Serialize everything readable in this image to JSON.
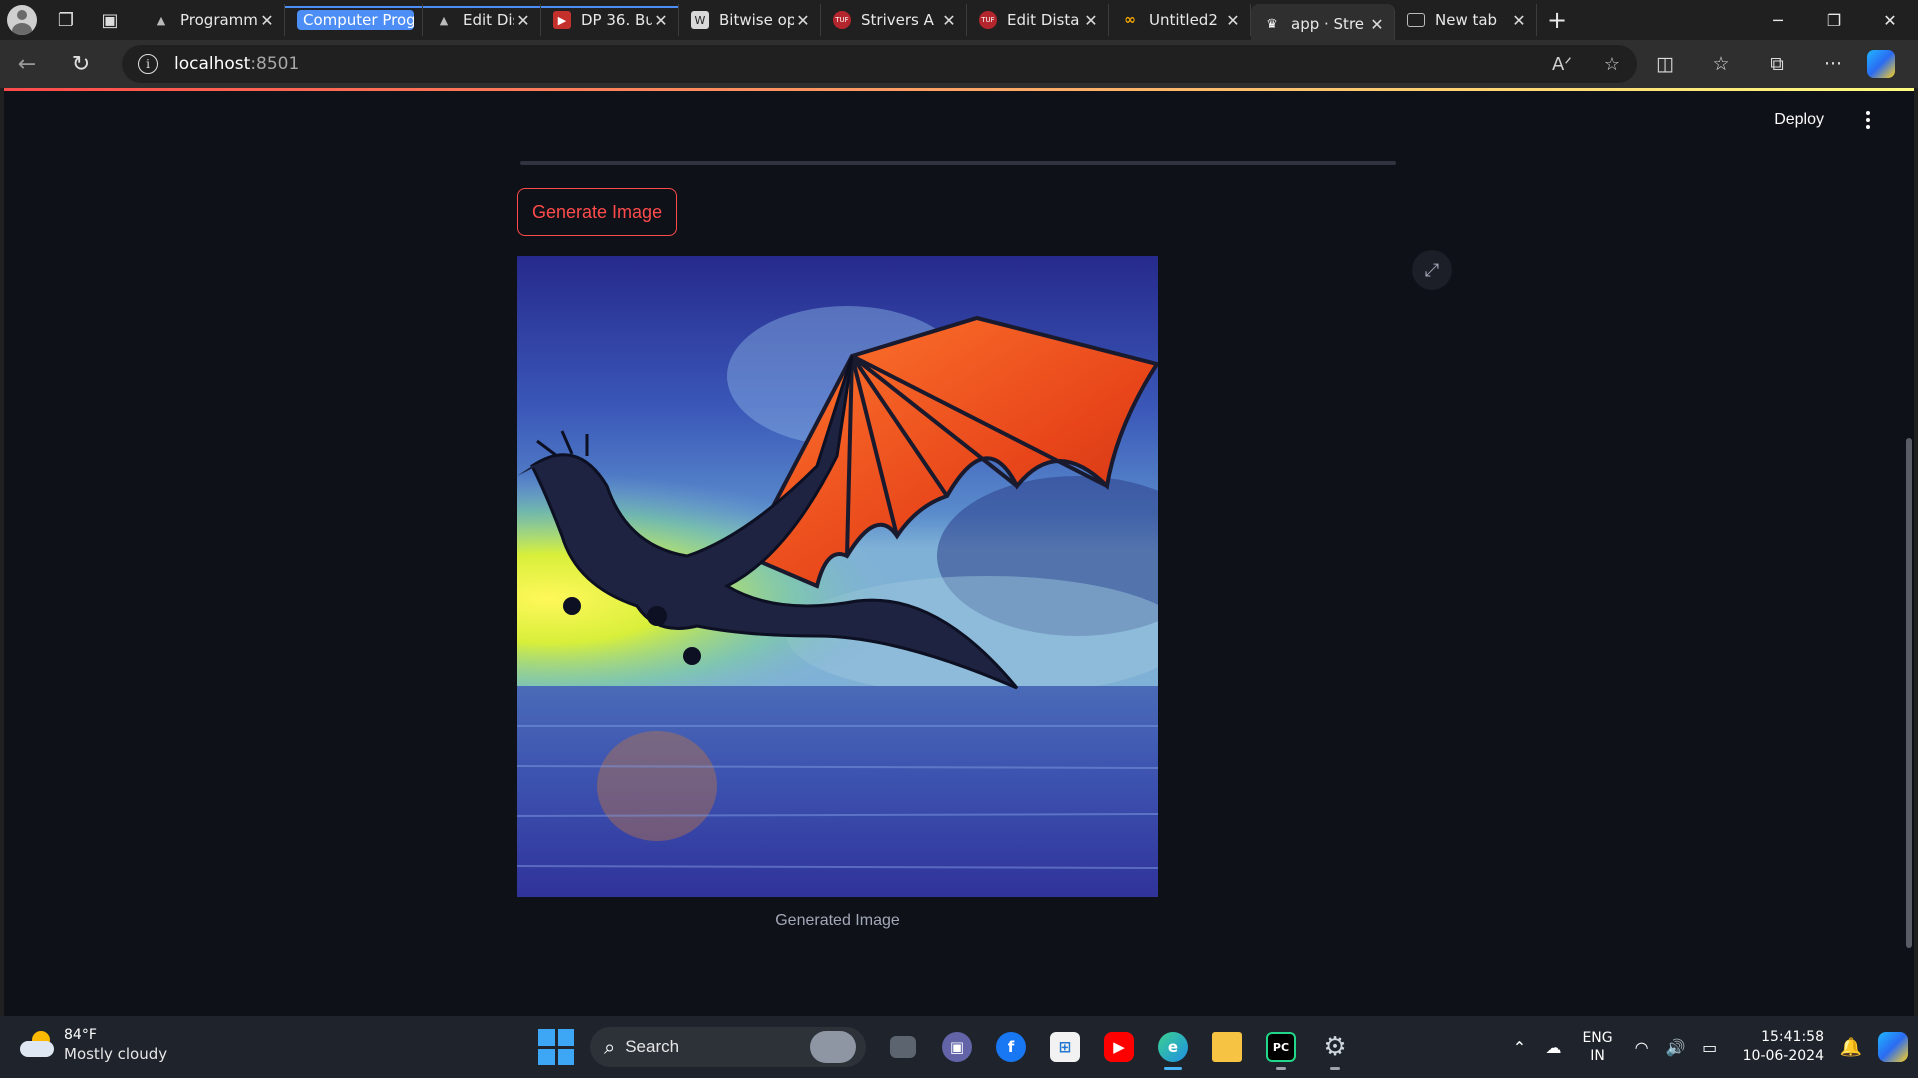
{
  "browser": {
    "tabs": [
      {
        "title": "Programm",
        "favicon": "mountain-icon",
        "group": false
      },
      {
        "title": "Computer Programmin",
        "favicon": "",
        "group": true
      },
      {
        "title": "Edit Dista",
        "favicon": "mountain-icon",
        "group": false
      },
      {
        "title": "DP 36. Bu",
        "favicon": "youtube-icon",
        "group": false
      },
      {
        "title": "Bitwise op",
        "favicon": "wikipedia-icon",
        "group": false
      },
      {
        "title": "Strivers A",
        "favicon": "tuf-icon",
        "group": false
      },
      {
        "title": "Edit Dista",
        "favicon": "tuf-icon",
        "group": false
      },
      {
        "title": "Untitled2",
        "favicon": "colab-icon",
        "group": false
      },
      {
        "title": "app · Stre",
        "favicon": "streamlit-crown-icon",
        "group": false,
        "active": true
      },
      {
        "title": "New tab",
        "favicon": "newtab-icon",
        "group": false
      }
    ],
    "url_host": "localhost",
    "url_port": ":8501"
  },
  "app": {
    "deploy_label": "Deploy",
    "generate_button_label": "Generate Image",
    "image_caption": "Generated Image",
    "image_alt": "dragon-image"
  },
  "taskbar": {
    "weather_temp": "84°F",
    "weather_desc": "Mostly cloudy",
    "search_label": "Search",
    "lang_line1": "ENG",
    "lang_line2": "IN",
    "time": "15:41:58",
    "date": "10-06-2024"
  },
  "colors": {
    "page_bg": "#0e1117",
    "accent": "#ff4b4b",
    "browser_bg": "#202020"
  }
}
